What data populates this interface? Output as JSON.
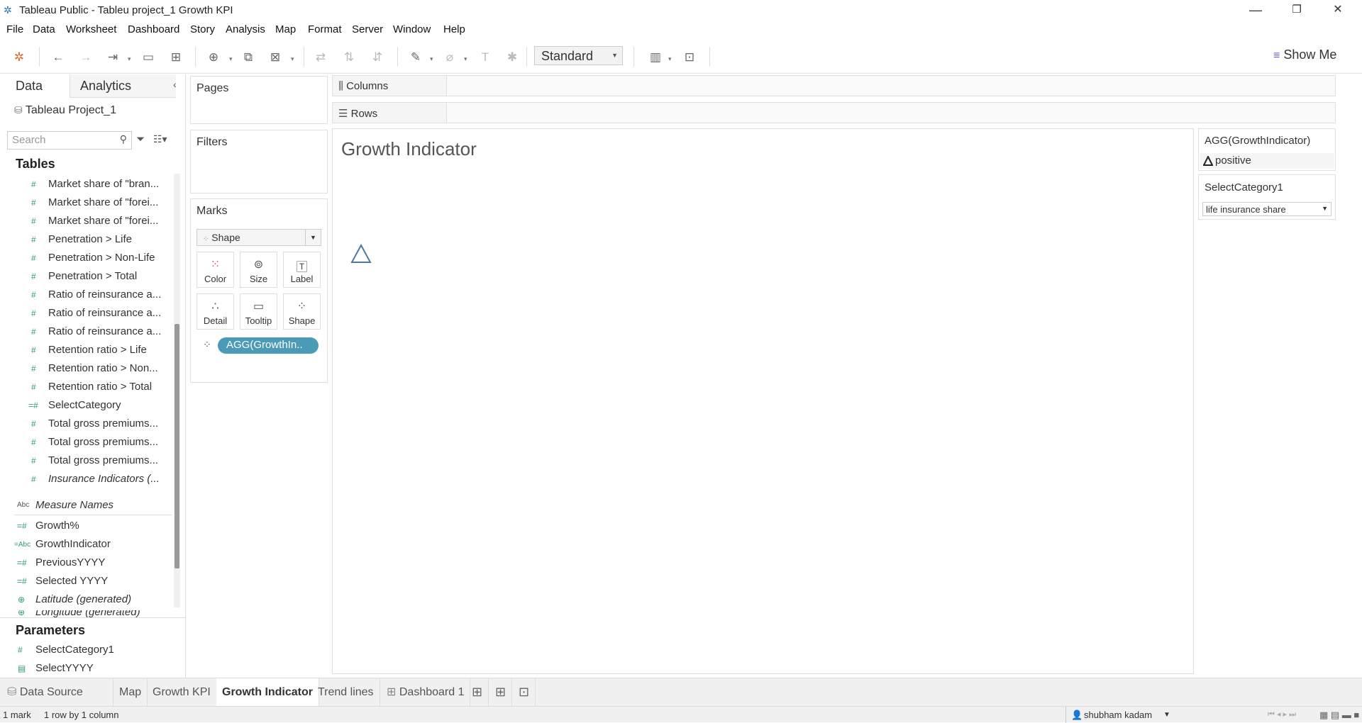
{
  "window": {
    "title": "Tableau Public - Tableu project_1 Growth KPI",
    "minimize": "—",
    "restore": "❐",
    "close": "✕"
  },
  "menu": [
    "File",
    "Data",
    "Worksheet",
    "Dashboard",
    "Story",
    "Analysis",
    "Map",
    "Format",
    "Server",
    "Window",
    "Help"
  ],
  "toolbar": {
    "fit_value": "Standard",
    "show_me": "Show Me"
  },
  "left_pane": {
    "tabs": [
      "Data",
      "Analytics"
    ],
    "datasource": "Tableau Project_1",
    "search_placeholder": "Search",
    "tables_heading": "Tables",
    "table_fields": [
      "Market share of \"bran...",
      "Market share of \"forei...",
      "Market share of \"forei...",
      "Penetration > Life",
      "Penetration > Non-Life",
      "Penetration > Total",
      "Ratio of reinsurance a...",
      "Ratio of reinsurance a...",
      "Ratio of reinsurance a...",
      "Retention ratio > Life",
      "Retention ratio > Non...",
      "Retention ratio > Total",
      "SelectCategory",
      "Total gross premiums...",
      "Total gross premiums...",
      "Total gross premiums...",
      "Insurance Indicators (..."
    ],
    "measure_names": "Measure Names",
    "calc_fields": [
      "Growth%",
      "GrowthIndicator",
      "PreviousYYYY",
      "Selected YYYY",
      "Latitude (generated)",
      "Longitude (generated)"
    ],
    "parameters_heading": "Parameters",
    "parameters": [
      "SelectCategory1",
      "SelectYYYY"
    ]
  },
  "shelves": {
    "pages": "Pages",
    "filters": "Filters",
    "marks": "Marks",
    "mark_type": "Shape",
    "mark_buttons": [
      "Color",
      "Size",
      "Label",
      "Detail",
      "Tooltip",
      "Shape"
    ],
    "shape_pill": "AGG(GrowthIn..",
    "columns": "Columns",
    "rows": "Rows"
  },
  "viz": {
    "title": "Growth Indicator"
  },
  "legend": {
    "title": "AGG(GrowthIndicator)",
    "item": "positive"
  },
  "parameter_control": {
    "title": "SelectCategory1",
    "value": "life insurance share"
  },
  "sheet_tabs": [
    "Data Source",
    "Map",
    "Growth KPI",
    "Growth Indicator",
    "Trend lines",
    "Dashboard 1"
  ],
  "status": {
    "marks": "1 mark",
    "dims": "1 row by 1 column",
    "user": "shubham kadam"
  }
}
